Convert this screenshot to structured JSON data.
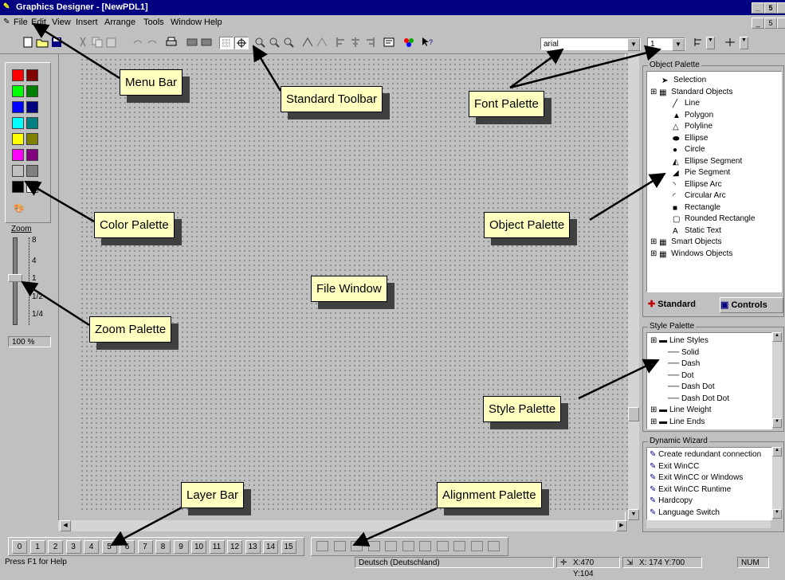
{
  "window": {
    "title": "Graphics Designer - [NewPDL1]",
    "min": "_",
    "max": "5",
    "close": "x"
  },
  "menu": {
    "items": [
      "File",
      "Edit",
      "View",
      "Insert",
      "Arrange",
      "Tools",
      "Window",
      "Help"
    ]
  },
  "toolbar": {
    "font_name": "arial",
    "font_size": "1"
  },
  "zoom": {
    "title": "Zoom",
    "ticks": [
      "8",
      "4",
      "1",
      "1/2",
      "1/4"
    ],
    "value": "100 %"
  },
  "colors": [
    "#ff0000",
    "#800000",
    "#00ff00",
    "#008000",
    "#0000ff",
    "#000080",
    "#00ffff",
    "#008080",
    "#ffff00",
    "#808000",
    "#ff00ff",
    "#800080",
    "#c0c0c0",
    "#808080",
    "#000000",
    "#ffffff"
  ],
  "object_palette": {
    "title": "Object Palette",
    "items": [
      {
        "label": "Selection",
        "level": 1,
        "icon": "arrow-icon"
      },
      {
        "label": "Standard Objects",
        "level": 0,
        "icon": "folder-icon"
      },
      {
        "label": "Line",
        "level": 2,
        "icon": "line-icon"
      },
      {
        "label": "Polygon",
        "level": 2,
        "icon": "polygon-icon"
      },
      {
        "label": "Polyline",
        "level": 2,
        "icon": "polyline-icon"
      },
      {
        "label": "Ellipse",
        "level": 2,
        "icon": "ellipse-icon"
      },
      {
        "label": "Circle",
        "level": 2,
        "icon": "circle-icon"
      },
      {
        "label": "Ellipse Segment",
        "level": 2,
        "icon": "ellipse-segment-icon"
      },
      {
        "label": "Pie Segment",
        "level": 2,
        "icon": "pie-segment-icon"
      },
      {
        "label": "Ellipse Arc",
        "level": 2,
        "icon": "ellipse-arc-icon"
      },
      {
        "label": "Circular Arc",
        "level": 2,
        "icon": "circular-arc-icon"
      },
      {
        "label": "Rectangle",
        "level": 2,
        "icon": "rectangle-icon"
      },
      {
        "label": "Rounded Rectangle",
        "level": 2,
        "icon": "rounded-rectangle-icon"
      },
      {
        "label": "Static Text",
        "level": 2,
        "icon": "static-text-icon"
      },
      {
        "label": "Smart Objects",
        "level": 0,
        "icon": "folder-icon"
      },
      {
        "label": "Windows Objects",
        "level": 0,
        "icon": "folder-icon"
      }
    ],
    "tabs": [
      "Standard",
      "Controls"
    ]
  },
  "style_palette": {
    "title": "Style Palette",
    "items": [
      {
        "label": "Line Styles",
        "level": 0
      },
      {
        "label": "Solid",
        "level": 1
      },
      {
        "label": "Dash",
        "level": 1
      },
      {
        "label": "Dot",
        "level": 1
      },
      {
        "label": "Dash Dot",
        "level": 1
      },
      {
        "label": "Dash Dot Dot",
        "level": 1
      },
      {
        "label": "Line Weight",
        "level": 0
      },
      {
        "label": "Line Ends",
        "level": 0
      }
    ]
  },
  "dynamic_wizard": {
    "title": "Dynamic Wizard",
    "items": [
      "Create redundant connection",
      "Exit WinCC",
      "Exit WinCC or Windows",
      "Exit WinCC Runtime",
      "Hardcopy",
      "Language Switch"
    ]
  },
  "layers": [
    "0",
    "1",
    "2",
    "3",
    "4",
    "5",
    "6",
    "7",
    "8",
    "9",
    "10",
    "11",
    "12",
    "13",
    "14",
    "15"
  ],
  "status": {
    "help": "Press F1 for Help",
    "language": "Deutsch (Deutschland)",
    "position": "X:470 Y:104",
    "size": "X: 174 Y:700",
    "num": "NUM"
  },
  "callouts": {
    "menu_bar": "Menu Bar",
    "standard_toolbar": "Standard Toolbar",
    "font_palette": "Font Palette",
    "color_palette": "Color Palette",
    "object_palette": "Object Palette",
    "file_window": "File Window",
    "zoom_palette": "Zoom Palette",
    "style_palette": "Style Palette",
    "layer_bar": "Layer Bar",
    "alignment_palette": "Alignment Palette"
  }
}
